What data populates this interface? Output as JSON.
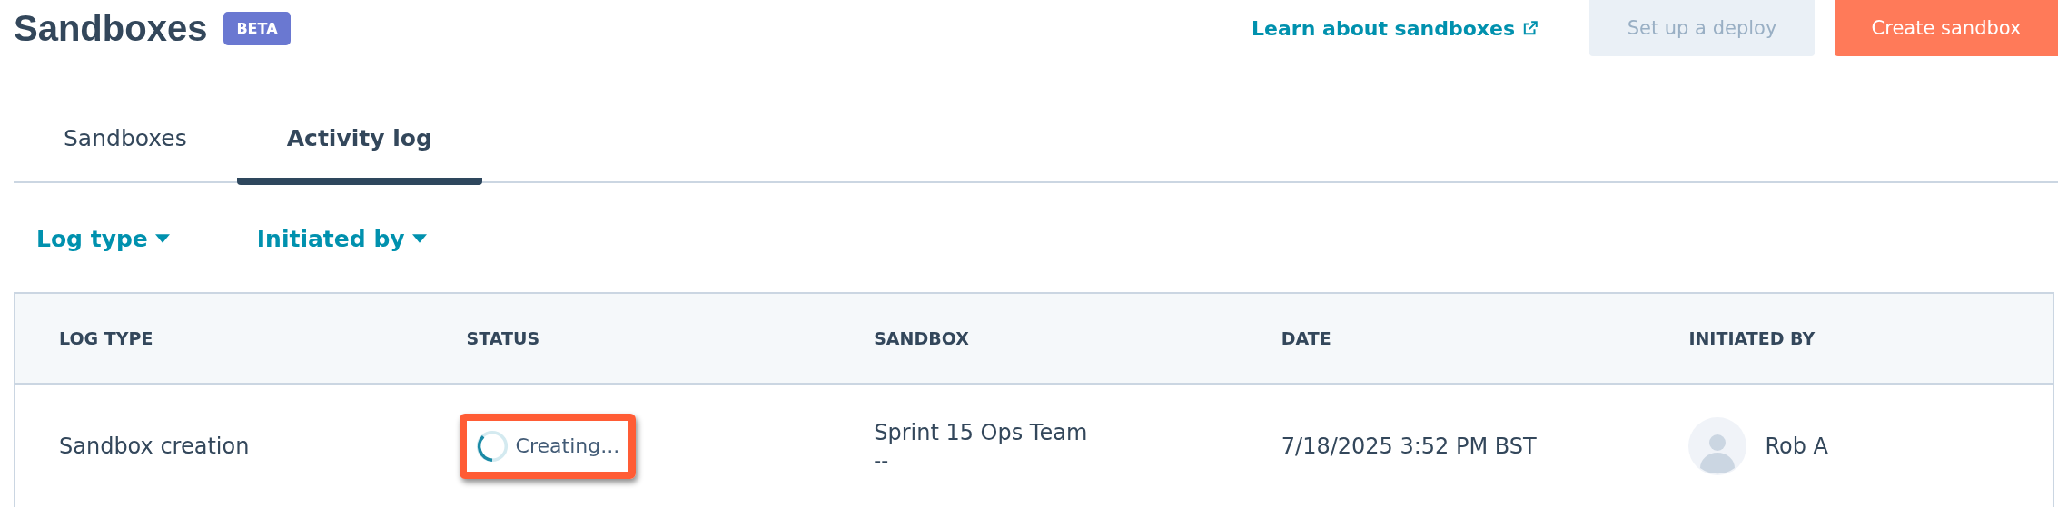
{
  "header": {
    "title": "Sandboxes",
    "badge": "BETA",
    "link": "Learn about sandboxes",
    "buttons": [
      {
        "label": "Set up a deploy",
        "kind": "secondary",
        "disabled": true
      },
      {
        "label": "Create sandbox",
        "kind": "primary",
        "disabled": false
      }
    ]
  },
  "tabs": [
    {
      "label": "Sandboxes",
      "selected": false
    },
    {
      "label": "Activity log",
      "selected": true
    }
  ],
  "filters": [
    {
      "label": "Log type"
    },
    {
      "label": "Initiated by"
    }
  ],
  "table": {
    "columns": [
      "LOG TYPE",
      "STATUS",
      "SANDBOX",
      "DATE",
      "INITIATED BY"
    ],
    "rows": [
      {
        "log_type": "Sandbox creation",
        "status": "Creating...",
        "status_highlighted": true,
        "sandbox": "Sprint 15 Ops Team",
        "sandbox_sub": "--",
        "date": "7/18/2025 3:52 PM BST",
        "initiated_by": "Rob A"
      }
    ]
  }
}
